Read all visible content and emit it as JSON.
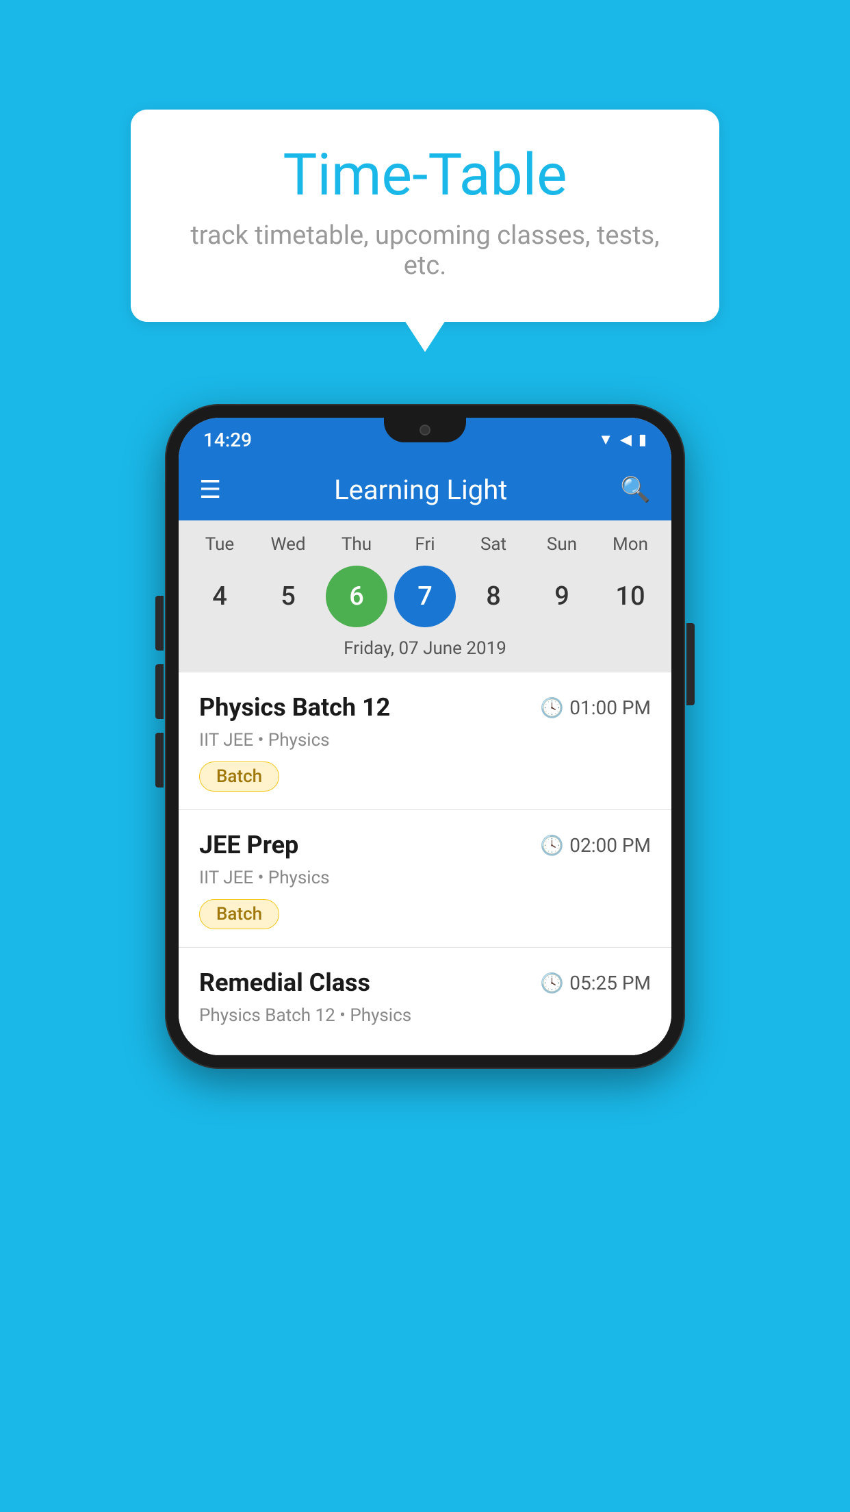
{
  "background_color": "#1ab8e8",
  "tooltip": {
    "title": "Time-Table",
    "subtitle": "track timetable, upcoming classes, tests, etc."
  },
  "phone": {
    "status_bar": {
      "time": "14:29"
    },
    "app_bar": {
      "title": "Learning Light"
    },
    "calendar": {
      "weekdays": [
        "Tue",
        "Wed",
        "Thu",
        "Fri",
        "Sat",
        "Sun",
        "Mon"
      ],
      "dates": [
        {
          "num": "4",
          "state": "normal"
        },
        {
          "num": "5",
          "state": "normal"
        },
        {
          "num": "6",
          "state": "today"
        },
        {
          "num": "7",
          "state": "selected"
        },
        {
          "num": "8",
          "state": "normal"
        },
        {
          "num": "9",
          "state": "normal"
        },
        {
          "num": "10",
          "state": "normal"
        }
      ],
      "selected_label": "Friday, 07 June 2019"
    },
    "classes": [
      {
        "name": "Physics Batch 12",
        "time": "01:00 PM",
        "meta": "IIT JEE • Physics",
        "badge": "Batch"
      },
      {
        "name": "JEE Prep",
        "time": "02:00 PM",
        "meta": "IIT JEE • Physics",
        "badge": "Batch"
      },
      {
        "name": "Remedial Class",
        "time": "05:25 PM",
        "meta": "Physics Batch 12 • Physics",
        "badge": ""
      }
    ]
  }
}
